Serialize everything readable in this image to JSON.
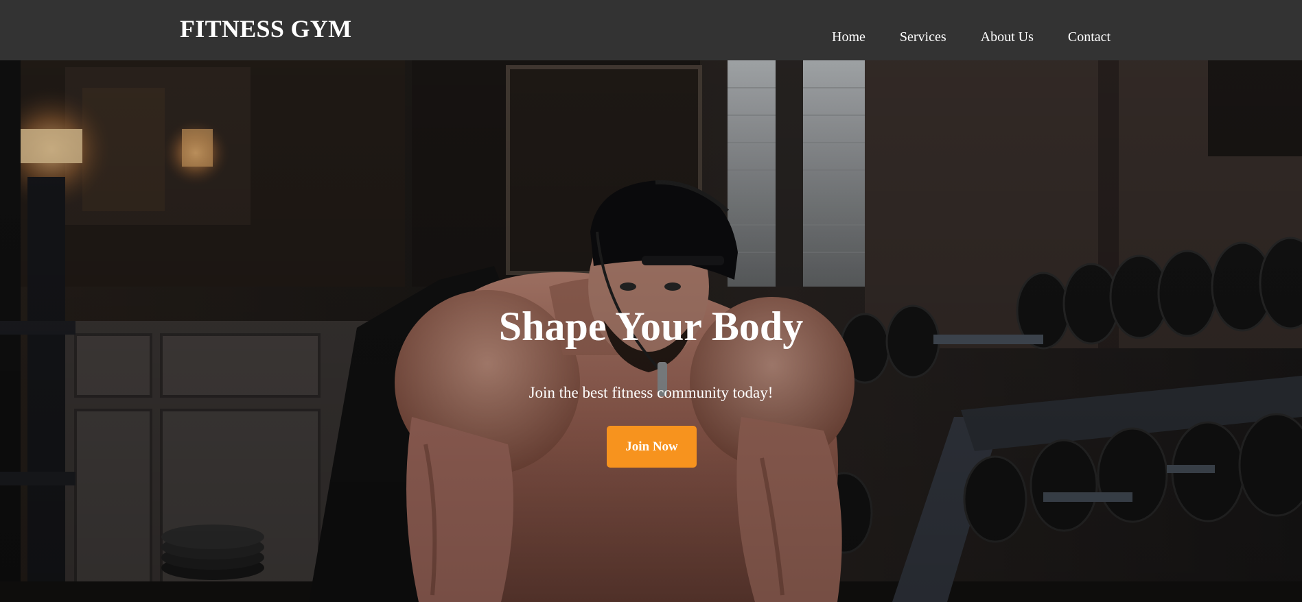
{
  "header": {
    "brand": "FITNESS GYM",
    "nav": [
      {
        "label": "Home"
      },
      {
        "label": "Services"
      },
      {
        "label": "About Us"
      },
      {
        "label": "Contact"
      }
    ]
  },
  "hero": {
    "title": "Shape Your Body",
    "subtitle": "Join the best fitness community today!",
    "cta_label": "Join Now",
    "image_alt": "Muscular man leaning forward in a dark gym with dumbbell racks"
  },
  "colors": {
    "navbar_bg": "#333333",
    "text": "#ffffff",
    "accent": "#f7931e"
  }
}
